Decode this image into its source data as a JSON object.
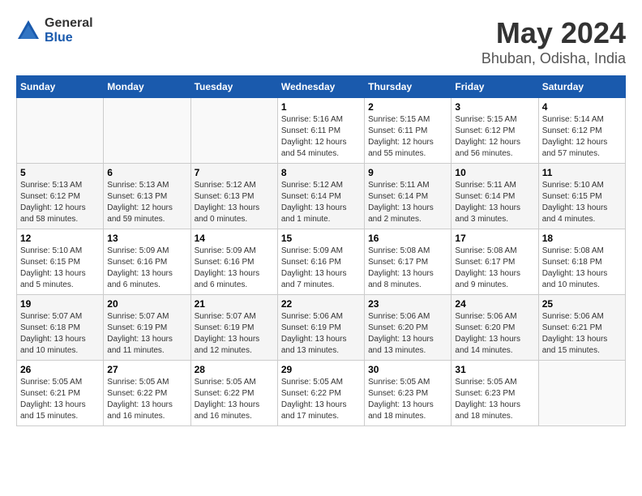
{
  "logo": {
    "general": "General",
    "blue": "Blue"
  },
  "title": "May 2024",
  "subtitle": "Bhuban, Odisha, India",
  "days_of_week": [
    "Sunday",
    "Monday",
    "Tuesday",
    "Wednesday",
    "Thursday",
    "Friday",
    "Saturday"
  ],
  "weeks": [
    [
      {
        "num": "",
        "info": ""
      },
      {
        "num": "",
        "info": ""
      },
      {
        "num": "",
        "info": ""
      },
      {
        "num": "1",
        "info": "Sunrise: 5:16 AM\nSunset: 6:11 PM\nDaylight: 12 hours and 54 minutes."
      },
      {
        "num": "2",
        "info": "Sunrise: 5:15 AM\nSunset: 6:11 PM\nDaylight: 12 hours and 55 minutes."
      },
      {
        "num": "3",
        "info": "Sunrise: 5:15 AM\nSunset: 6:12 PM\nDaylight: 12 hours and 56 minutes."
      },
      {
        "num": "4",
        "info": "Sunrise: 5:14 AM\nSunset: 6:12 PM\nDaylight: 12 hours and 57 minutes."
      }
    ],
    [
      {
        "num": "5",
        "info": "Sunrise: 5:13 AM\nSunset: 6:12 PM\nDaylight: 12 hours and 58 minutes."
      },
      {
        "num": "6",
        "info": "Sunrise: 5:13 AM\nSunset: 6:13 PM\nDaylight: 12 hours and 59 minutes."
      },
      {
        "num": "7",
        "info": "Sunrise: 5:12 AM\nSunset: 6:13 PM\nDaylight: 13 hours and 0 minutes."
      },
      {
        "num": "8",
        "info": "Sunrise: 5:12 AM\nSunset: 6:14 PM\nDaylight: 13 hours and 1 minute."
      },
      {
        "num": "9",
        "info": "Sunrise: 5:11 AM\nSunset: 6:14 PM\nDaylight: 13 hours and 2 minutes."
      },
      {
        "num": "10",
        "info": "Sunrise: 5:11 AM\nSunset: 6:14 PM\nDaylight: 13 hours and 3 minutes."
      },
      {
        "num": "11",
        "info": "Sunrise: 5:10 AM\nSunset: 6:15 PM\nDaylight: 13 hours and 4 minutes."
      }
    ],
    [
      {
        "num": "12",
        "info": "Sunrise: 5:10 AM\nSunset: 6:15 PM\nDaylight: 13 hours and 5 minutes."
      },
      {
        "num": "13",
        "info": "Sunrise: 5:09 AM\nSunset: 6:16 PM\nDaylight: 13 hours and 6 minutes."
      },
      {
        "num": "14",
        "info": "Sunrise: 5:09 AM\nSunset: 6:16 PM\nDaylight: 13 hours and 6 minutes."
      },
      {
        "num": "15",
        "info": "Sunrise: 5:09 AM\nSunset: 6:16 PM\nDaylight: 13 hours and 7 minutes."
      },
      {
        "num": "16",
        "info": "Sunrise: 5:08 AM\nSunset: 6:17 PM\nDaylight: 13 hours and 8 minutes."
      },
      {
        "num": "17",
        "info": "Sunrise: 5:08 AM\nSunset: 6:17 PM\nDaylight: 13 hours and 9 minutes."
      },
      {
        "num": "18",
        "info": "Sunrise: 5:08 AM\nSunset: 6:18 PM\nDaylight: 13 hours and 10 minutes."
      }
    ],
    [
      {
        "num": "19",
        "info": "Sunrise: 5:07 AM\nSunset: 6:18 PM\nDaylight: 13 hours and 10 minutes."
      },
      {
        "num": "20",
        "info": "Sunrise: 5:07 AM\nSunset: 6:19 PM\nDaylight: 13 hours and 11 minutes."
      },
      {
        "num": "21",
        "info": "Sunrise: 5:07 AM\nSunset: 6:19 PM\nDaylight: 13 hours and 12 minutes."
      },
      {
        "num": "22",
        "info": "Sunrise: 5:06 AM\nSunset: 6:19 PM\nDaylight: 13 hours and 13 minutes."
      },
      {
        "num": "23",
        "info": "Sunrise: 5:06 AM\nSunset: 6:20 PM\nDaylight: 13 hours and 13 minutes."
      },
      {
        "num": "24",
        "info": "Sunrise: 5:06 AM\nSunset: 6:20 PM\nDaylight: 13 hours and 14 minutes."
      },
      {
        "num": "25",
        "info": "Sunrise: 5:06 AM\nSunset: 6:21 PM\nDaylight: 13 hours and 15 minutes."
      }
    ],
    [
      {
        "num": "26",
        "info": "Sunrise: 5:05 AM\nSunset: 6:21 PM\nDaylight: 13 hours and 15 minutes."
      },
      {
        "num": "27",
        "info": "Sunrise: 5:05 AM\nSunset: 6:22 PM\nDaylight: 13 hours and 16 minutes."
      },
      {
        "num": "28",
        "info": "Sunrise: 5:05 AM\nSunset: 6:22 PM\nDaylight: 13 hours and 16 minutes."
      },
      {
        "num": "29",
        "info": "Sunrise: 5:05 AM\nSunset: 6:22 PM\nDaylight: 13 hours and 17 minutes."
      },
      {
        "num": "30",
        "info": "Sunrise: 5:05 AM\nSunset: 6:23 PM\nDaylight: 13 hours and 18 minutes."
      },
      {
        "num": "31",
        "info": "Sunrise: 5:05 AM\nSunset: 6:23 PM\nDaylight: 13 hours and 18 minutes."
      },
      {
        "num": "",
        "info": ""
      }
    ]
  ]
}
